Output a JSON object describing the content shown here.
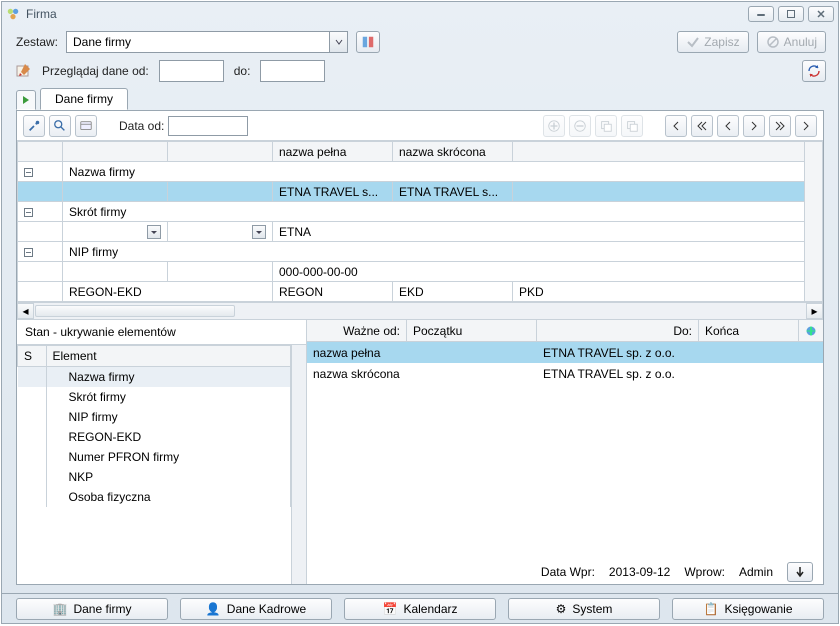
{
  "window": {
    "title": "Firma"
  },
  "top": {
    "zestaw_label": "Zestaw:",
    "zestaw_value": "Dane firmy",
    "save_label": "Zapisz",
    "cancel_label": "Anuluj",
    "browse_label": "Przeglądaj dane od:",
    "browse_from": "",
    "to_label": "do:",
    "browse_to": ""
  },
  "tab": {
    "label": "Dane firmy"
  },
  "inner_tb": {
    "date_from_label": "Data od:",
    "date_from_val": ""
  },
  "grid": {
    "head_col3": "nazwa pełna",
    "head_col4": "nazwa skrócona",
    "r1_label": "Nazwa firmy",
    "r1_c3": "ETNA TRAVEL s...",
    "r1_c4": "ETNA TRAVEL s...",
    "r2_label": "Skrót firmy",
    "r2_c3": "ETNA",
    "r3_label": "NIP firmy",
    "r3_c3": "000-000-00-00",
    "r4_label": "REGON-EKD",
    "r4_c3": "REGON",
    "r4_c4": "EKD",
    "r4_c5": "PKD"
  },
  "left": {
    "caption": "Stan - ukrywanie elementów",
    "col_s": "S",
    "col_el": "Element",
    "items": [
      "Nazwa firmy",
      "Skrót firmy",
      "NIP firmy",
      "REGON-EKD",
      "Numer PFRON firmy",
      "NKP",
      "Osoba fizyczna"
    ]
  },
  "right": {
    "h1": "Ważne od:",
    "h1v": "Początku",
    "h2": "Do:",
    "h2v": "Końca",
    "rows": [
      {
        "name": "nazwa pełna",
        "val": "ETNA TRAVEL sp. z o.o."
      },
      {
        "name": "nazwa skrócona",
        "val": "ETNA TRAVEL sp. z o.o."
      }
    ]
  },
  "status": {
    "l1": "Data Wpr:",
    "v1": "2013-09-12",
    "l2": "Wprow:",
    "v2": "Admin"
  },
  "modules": [
    "Dane firmy",
    "Dane Kadrowe",
    "Kalendarz",
    "System",
    "Księgowanie"
  ]
}
